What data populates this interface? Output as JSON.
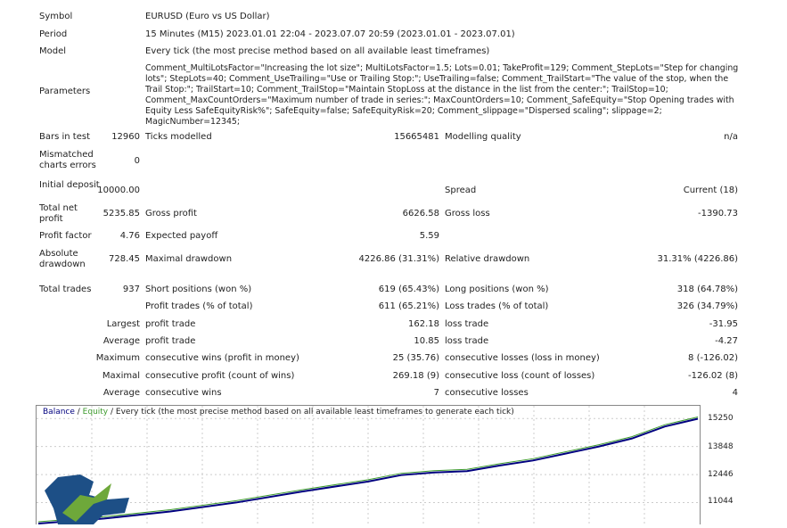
{
  "header": {
    "symbol_label": "Symbol",
    "symbol": "EURUSD (Euro vs US Dollar)",
    "period_label": "Period",
    "period": "15 Minutes (M15) 2023.01.01 22:04 - 2023.07.07 20:59 (2023.01.01 - 2023.07.01)",
    "model_label": "Model",
    "model": "Every tick (the most precise method based on all available least timeframes)",
    "parameters_label": "Parameters",
    "parameters": "Comment_MultiLotsFactor=\"Increasing the lot size\"; MultiLotsFactor=1.5; Lots=0.01; TakeProfit=129; Comment_StepLots=\"Step for changing lots\"; StepLots=40; Comment_UseTrailing=\"Use or Trailing Stop:\"; UseTrailing=false; Comment_TrailStart=\"The value of the stop, when the Trail Stop:\"; TrailStart=10; Comment_TrailStop=\"Maintain StopLoss at the distance in the list from the center:\"; TrailStop=10; Comment_MaxCountOrders=\"Maximum number of trade in series:\"; MaxCountOrders=10; Comment_SafeEquity=\"Stop Opening trades with Equity Less SafeEquityRisk%\"; SafeEquity=false; SafeEquityRisk=20; Comment_slippage=\"Dispersed scaling\"; slippage=2; MagicNumber=12345;"
  },
  "rows": [
    {
      "y": 148,
      "c": [
        [
          "Bars in test",
          "12960"
        ],
        [
          "Ticks modelled",
          "15665481"
        ],
        [
          "Modelling quality",
          "n/a"
        ]
      ]
    },
    {
      "y": 208,
      "c": [
        [
          "Initial deposit",
          "10000.00"
        ],
        [
          "",
          ""
        ],
        [
          "Spread",
          "Current (18)"
        ]
      ]
    },
    {
      "y": 234,
      "c": [
        [
          "Total net profit",
          "5235.85"
        ],
        [
          "Gross profit",
          "6626.58"
        ],
        [
          "Gross loss",
          "-1390.73"
        ]
      ]
    },
    {
      "y": 259,
      "c": [
        [
          "Profit factor",
          "4.76"
        ],
        [
          "Expected payoff",
          "5.59"
        ],
        [
          "",
          ""
        ]
      ]
    },
    {
      "y": 285,
      "c": [
        [
          "Absolute drawdown",
          "728.45"
        ],
        [
          "Maximal drawdown",
          "4226.86 (31.31%)"
        ],
        [
          "Relative drawdown",
          "31.31% (4226.86)"
        ]
      ]
    },
    {
      "y": 319,
      "c": [
        [
          "Total trades",
          "937"
        ],
        [
          "Short positions (won %)",
          "619 (65.43%)"
        ],
        [
          "Long positions (won %)",
          "318 (64.78%)"
        ]
      ]
    },
    {
      "y": 338,
      "c": [
        [
          "",
          ""
        ],
        [
          "Profit trades (% of total)",
          "611 (65.21%)"
        ],
        [
          "Loss trades (% of total)",
          "326 (34.79%)"
        ]
      ]
    },
    {
      "y": 358,
      "c": [
        [
          "",
          "Largest"
        ],
        [
          "profit trade",
          "162.18"
        ],
        [
          "loss trade",
          "-31.95"
        ]
      ]
    },
    {
      "y": 377,
      "c": [
        [
          "",
          "Average"
        ],
        [
          "profit trade",
          "10.85"
        ],
        [
          "loss trade",
          "-4.27"
        ]
      ]
    },
    {
      "y": 396,
      "c": [
        [
          "",
          "Maximum"
        ],
        [
          "consecutive wins (profit in money)",
          "25 (35.76)"
        ],
        [
          "consecutive losses (loss in money)",
          "8 (-126.02)"
        ]
      ]
    },
    {
      "y": 416,
      "c": [
        [
          "",
          "Maximal"
        ],
        [
          "consecutive profit (count of wins)",
          "269.18 (9)"
        ],
        [
          "consecutive loss (count of losses)",
          "-126.02 (8)"
        ]
      ]
    },
    {
      "y": 435,
      "c": [
        [
          "",
          "Average"
        ],
        [
          "consecutive wins",
          "7"
        ],
        [
          "consecutive losses",
          "4"
        ]
      ]
    }
  ],
  "mismatched": {
    "label": "Mismatched charts errors",
    "value": "0"
  },
  "chart_data": {
    "type": "line",
    "legend": {
      "balance": "Balance",
      "equity": "Equity",
      "rest": " / Every tick (the most precise method based on all available least timeframes to generate each tick)"
    },
    "y_ticks": [
      "15250",
      "13848",
      "12446",
      "11044"
    ],
    "ylim": [
      9910,
      15883
    ],
    "grid": true,
    "colors": {
      "balance": "#00007f",
      "equity": "#3c9a2c"
    },
    "series": [
      {
        "name": "Balance",
        "x": [
          0,
          10,
          20,
          30,
          40,
          50,
          55,
          60,
          65,
          70,
          75,
          80,
          85,
          90,
          95,
          100
        ],
        "values": [
          10000,
          10250,
          10600,
          11050,
          11600,
          12100,
          12420,
          12550,
          12620,
          12900,
          13150,
          13500,
          13850,
          14250,
          14850,
          15236
        ]
      }
    ]
  }
}
